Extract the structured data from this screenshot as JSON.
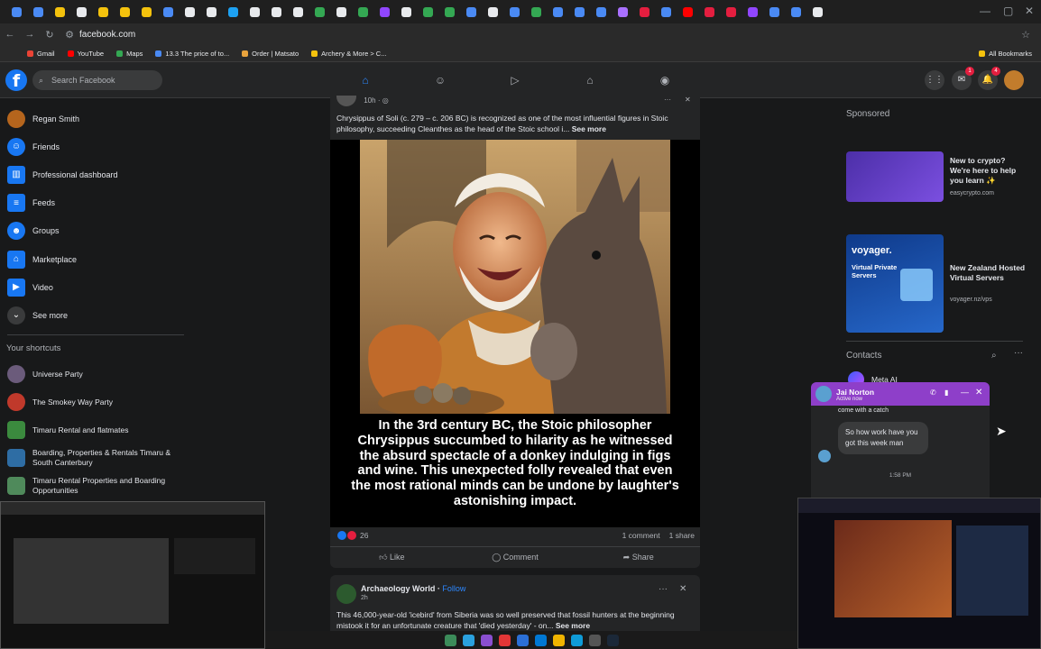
{
  "browser": {
    "url": "facebook.com",
    "bookmarks": [
      "Gmail",
      "YouTube",
      "Maps",
      "13.3 The price of to...",
      "Order | Matsato",
      "Archery & More > C...",
      "All Bookmarks"
    ],
    "tab_colors": [
      "#4a8af4",
      "#4a8af4",
      "#f4c20d",
      "#e8eaed",
      "#f4c20d",
      "#f4c20d",
      "#f4c20d",
      "#4a8af4",
      "#e8eaed",
      "#e8eaed",
      "#1da1f2",
      "#e8eaed",
      "#e8eaed",
      "#e8eaed",
      "#34a853",
      "#e8eaed",
      "#34a853",
      "#9146ff",
      "#e8eaed",
      "#34a853",
      "#34a853",
      "#4a8af4",
      "#e8eaed",
      "#4a8af4",
      "#34a853",
      "#4a8af4",
      "#4a8af4",
      "#4a8af4",
      "#a970ff",
      "#e41e3f",
      "#4a8af4",
      "#ff0000",
      "#e41e3f",
      "#e41e3f",
      "#9146ff",
      "#4a8af4",
      "#4a8af4",
      "#e8eaed"
    ]
  },
  "header": {
    "search_placeholder": "Search Facebook",
    "notification_badges": [
      "1",
      "4"
    ]
  },
  "sidebar": {
    "items": [
      {
        "label": "Regan Smith",
        "icon": "avatar",
        "color": "#b5651d"
      },
      {
        "label": "Friends",
        "icon": "friends-icon",
        "color": "#1877f2"
      },
      {
        "label": "Professional dashboard",
        "icon": "dashboard-icon",
        "color": "#1877f2"
      },
      {
        "label": "Feeds",
        "icon": "feeds-icon",
        "color": "#1877f2"
      },
      {
        "label": "Groups",
        "icon": "groups-icon",
        "color": "#1877f2"
      },
      {
        "label": "Marketplace",
        "icon": "marketplace-icon",
        "color": "#1877f2"
      },
      {
        "label": "Video",
        "icon": "video-icon",
        "color": "#1877f2"
      },
      {
        "label": "See more",
        "icon": "chevron-down-icon",
        "color": "#3a3b3c"
      }
    ],
    "shortcuts_title": "Your shortcuts",
    "shortcuts": [
      {
        "label": "Universe Party",
        "color": "#6b5b7b"
      },
      {
        "label": "The Smokey Way Party",
        "color": "#c0392b"
      },
      {
        "label": "Timaru Rental and flatmates",
        "color": "#3b8a3e"
      },
      {
        "label": "Boarding, Properties & Rentals Timaru & South Canterbury",
        "color": "#2e6da4"
      },
      {
        "label": "Timaru Rental Properties and Boarding Opportunities",
        "color": "#4f8a5b"
      }
    ]
  },
  "post1": {
    "time": "10h",
    "text": "Chrysippus of Soli (c. 279 – c. 206 BC) is recognized as one of the most influential figures in Stoic philosophy, succeeding Cleanthes as the head of the Stoic school i...",
    "see_more": "See more",
    "caption": "In the 3rd century BC, the Stoic philosopher Chrysippus succumbed to hilarity as he witnessed the absurd spectacle of a donkey indulging in figs and wine. This unexpected folly revealed that even the most rational minds can be undone by laughter's astonishing impact.",
    "reaction_count": "26",
    "comments": "1 comment",
    "shares": "1 share",
    "like_label": "Like",
    "comment_label": "Comment",
    "share_label": "Share"
  },
  "post2": {
    "page_name": "Archaeology World",
    "follow_label": "Follow",
    "time": "2h",
    "text": "This 46,000-year-old 'icebird' from Siberia was so well preserved that fossil hunters at the beginning mistook it for an unfortunate creature that 'died yesterday' - on...",
    "see_more": "See more"
  },
  "right": {
    "sponsored_title": "Sponsored",
    "ads": [
      {
        "title": "New to crypto? We're here to help you learn ✨",
        "domain": "easycrypto.com"
      },
      {
        "title": "New Zealand Hosted Virtual Servers",
        "domain": "voyager.nz/vps",
        "brand": "voyager.",
        "img_text": "Virtual Private Servers"
      }
    ],
    "contacts_title": "Contacts",
    "first_contact": "Meta AI"
  },
  "chat": {
    "name": "Jai Norton",
    "status": "Active now",
    "prev_message": "come with a catch",
    "message": "So how work have you got this week man",
    "time": "1:58 PM"
  }
}
